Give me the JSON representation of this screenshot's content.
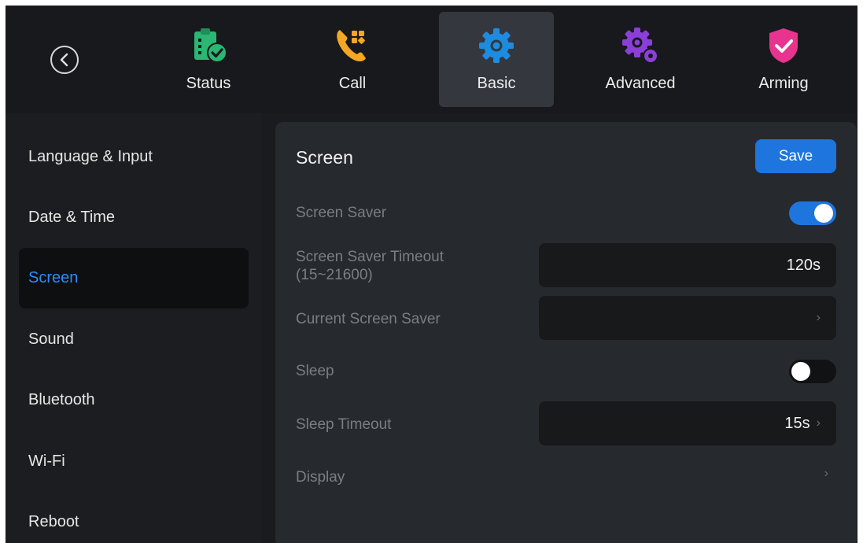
{
  "tabs": [
    {
      "label": "Status",
      "icon": "clipboard-check-icon",
      "color": "#2bb673"
    },
    {
      "label": "Call",
      "icon": "phone-grid-icon",
      "color": "#f5a623"
    },
    {
      "label": "Basic",
      "icon": "gear-icon",
      "color": "#1d8ce0",
      "active": true
    },
    {
      "label": "Advanced",
      "icon": "gears-icon",
      "color": "#8b3fd9"
    },
    {
      "label": "Arming",
      "icon": "shield-check-icon",
      "color": "#e8338f"
    }
  ],
  "sidebar": {
    "items": [
      {
        "label": "Language & Input"
      },
      {
        "label": "Date & Time"
      },
      {
        "label": "Screen",
        "active": true
      },
      {
        "label": "Sound"
      },
      {
        "label": "Bluetooth"
      },
      {
        "label": "Wi-Fi"
      },
      {
        "label": "Reboot"
      }
    ]
  },
  "panel": {
    "title": "Screen",
    "save_label": "Save",
    "screen_saver": {
      "label": "Screen Saver",
      "enabled": true
    },
    "screen_saver_timeout": {
      "label_line1": "Screen Saver Timeout",
      "label_line2": "(15~21600)",
      "value": "120s"
    },
    "current_screen_saver": {
      "label": "Current Screen Saver",
      "value": ""
    },
    "sleep": {
      "label": "Sleep",
      "enabled": false
    },
    "sleep_timeout": {
      "label": "Sleep Timeout",
      "value": "15s"
    },
    "display": {
      "label": "Display"
    }
  },
  "colors": {
    "accent": "#1d75dd",
    "active_text": "#2d8cff"
  }
}
